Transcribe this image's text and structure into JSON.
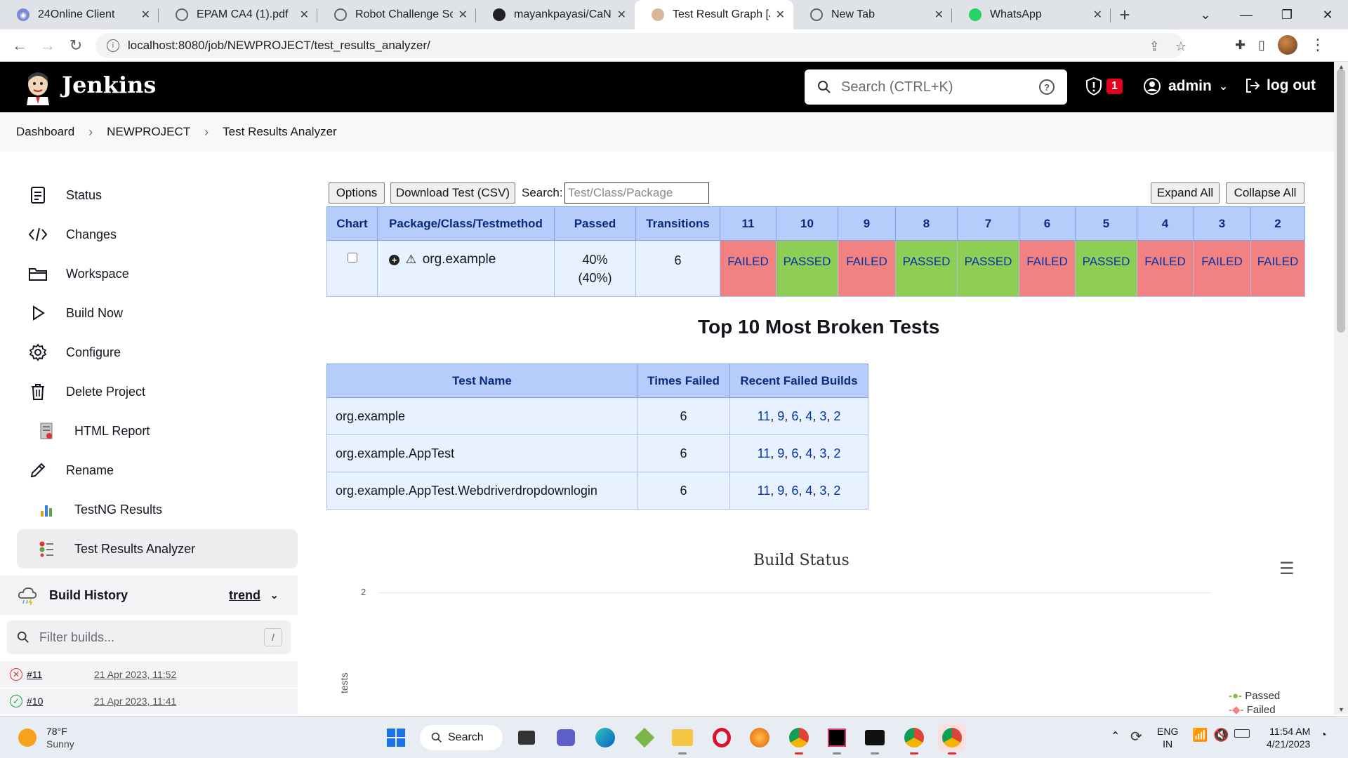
{
  "browser": {
    "tabs": [
      {
        "title": "24Online Client",
        "active": false
      },
      {
        "title": "EPAM CA4 (1).pdf",
        "active": false
      },
      {
        "title": "Robot Challenge Scre",
        "active": false
      },
      {
        "title": "mayankpayasi/CaNew",
        "active": false
      },
      {
        "title": "Test Result Graph [Jen",
        "active": true
      },
      {
        "title": "New Tab",
        "active": false
      },
      {
        "title": "WhatsApp",
        "active": false
      }
    ],
    "url": "localhost:8080/job/NEWPROJECT/test_results_analyzer/"
  },
  "jenkins": {
    "title": "Jenkins",
    "search_placeholder": "Search (CTRL+K)",
    "security_count": "1",
    "user": "admin",
    "logout": "log out"
  },
  "breadcrumbs": [
    "Dashboard",
    "NEWPROJECT",
    "Test Results Analyzer"
  ],
  "sidebar": {
    "items": [
      {
        "label": "Status",
        "icon": "status-icon"
      },
      {
        "label": "Changes",
        "icon": "code-icon"
      },
      {
        "label": "Workspace",
        "icon": "folder-icon"
      },
      {
        "label": "Build Now",
        "icon": "play-icon"
      },
      {
        "label": "Configure",
        "icon": "gear-icon"
      },
      {
        "label": "Delete Project",
        "icon": "trash-icon"
      },
      {
        "label": "HTML Report",
        "icon": "report-icon"
      },
      {
        "label": "Rename",
        "icon": "pencil-icon"
      },
      {
        "label": "TestNG Results",
        "icon": "testng-icon"
      },
      {
        "label": "Test Results Analyzer",
        "icon": "analyzer-icon"
      }
    ]
  },
  "build_history": {
    "title": "Build History",
    "trend": "trend",
    "filter_placeholder": "Filter builds...",
    "filter_shortcut": "/",
    "builds": [
      {
        "number": "#11",
        "date": "21 Apr 2023, 11:52",
        "status": "failed"
      },
      {
        "number": "#10",
        "date": "21 Apr 2023, 11:41",
        "status": "passed"
      }
    ]
  },
  "toolbar": {
    "options": "Options",
    "download": "Download Test (CSV)",
    "search_label": "Search:",
    "search_placeholder": "Test/Class/Package",
    "expand_all": "Expand All",
    "collapse_all": "Collapse All"
  },
  "results_table": {
    "headers": [
      "Chart",
      "Package/Class/Testmethod",
      "Passed",
      "Transitions"
    ],
    "builds": [
      "11",
      "10",
      "9",
      "8",
      "7",
      "6",
      "5",
      "4",
      "3",
      "2"
    ],
    "row": {
      "name": "org.example",
      "passed": "40%",
      "passed_paren": "(40%)",
      "transitions": "6",
      "statuses": [
        "FAILED",
        "PASSED",
        "FAILED",
        "PASSED",
        "PASSED",
        "FAILED",
        "PASSED",
        "FAILED",
        "FAILED",
        "FAILED"
      ]
    }
  },
  "broken": {
    "title": "Top 10 Most Broken Tests",
    "headers": [
      "Test Name",
      "Times Failed",
      "Recent Failed Builds"
    ],
    "rows": [
      {
        "name": "org.example",
        "times": "6",
        "builds": [
          "11",
          "9",
          "6",
          "4",
          "3",
          "2"
        ]
      },
      {
        "name": "org.example.AppTest",
        "times": "6",
        "builds": [
          "11",
          "9",
          "6",
          "4",
          "3",
          "2"
        ]
      },
      {
        "name": "org.example.AppTest.Webdriverdropdownlogin",
        "times": "6",
        "builds": [
          "11",
          "9",
          "6",
          "4",
          "3",
          "2"
        ]
      }
    ]
  },
  "chart": {
    "title": "Build Status",
    "y_tick_top": "2",
    "y_label_partial": "tests",
    "legend": [
      "Passed",
      "Failed"
    ],
    "colors": {
      "passed": "#7cc142",
      "failed": "#f28282",
      "header": "#b6cdfb"
    }
  },
  "taskbar": {
    "weather_temp": "78°F",
    "weather_desc": "Sunny",
    "search": "Search",
    "lang1": "ENG",
    "lang2": "IN",
    "time": "11:54 AM",
    "date": "4/21/2023"
  }
}
